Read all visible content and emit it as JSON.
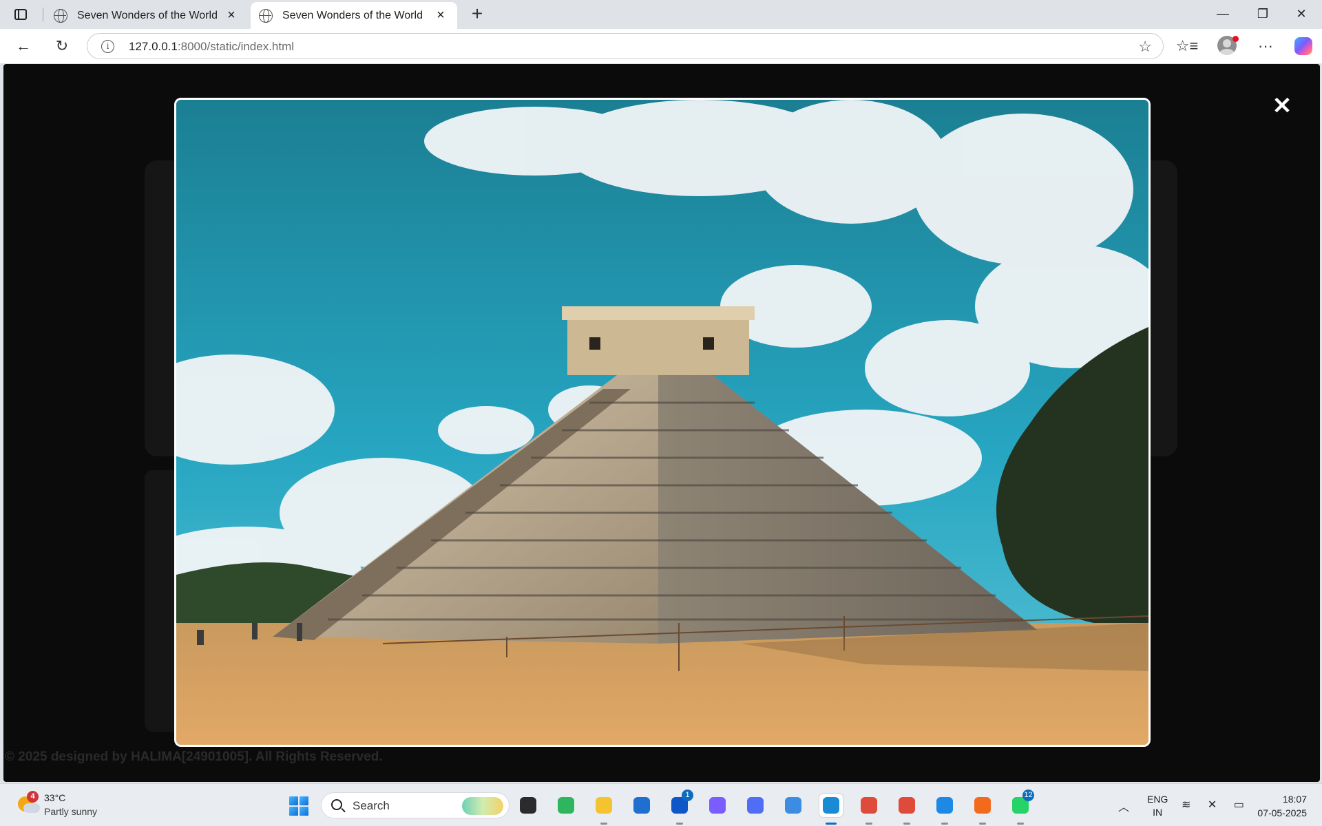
{
  "browser": {
    "tabs": [
      {
        "title": "Seven Wonders of the World",
        "active": false
      },
      {
        "title": "Seven Wonders of the World",
        "active": true
      }
    ],
    "new_tab_symbol": "+",
    "url_host": "127.0.0.1",
    "url_path": ":8000/static/index.html",
    "window_controls": {
      "minimize": "—",
      "restore": "❐",
      "close": "✕"
    }
  },
  "page": {
    "close_symbol": "✕",
    "footer": "© 2025 designed by HALIMA[24901005]. All Rights Reserved."
  },
  "taskbar": {
    "weather": {
      "temp": "33°C",
      "desc": "Partly sunny",
      "badge": "4"
    },
    "search_label": "Search",
    "apps": [
      {
        "name": "task-view",
        "color": "#2b2b2b"
      },
      {
        "name": "copilot-ring",
        "color": "#2fb55d"
      },
      {
        "name": "file-explorer",
        "color": "#f4c430"
      },
      {
        "name": "microsoft-store",
        "color": "#1f6fd1"
      },
      {
        "name": "l-app",
        "color": "#0f56c9",
        "badge": "1"
      },
      {
        "name": "copilot",
        "color": "#7b5cff"
      },
      {
        "name": "arc-app",
        "color": "#4f6df5"
      },
      {
        "name": "snipping-tool",
        "color": "#3a8de0"
      },
      {
        "name": "edge",
        "color": "#1a8ad4"
      },
      {
        "name": "chrome",
        "color": "#e04a3a"
      },
      {
        "name": "chrome-2",
        "color": "#e04a3a"
      },
      {
        "name": "vscode",
        "color": "#1e88e5"
      },
      {
        "name": "fiis-app",
        "color": "#f26a1b"
      },
      {
        "name": "whatsapp",
        "color": "#25d366",
        "badge": "12"
      }
    ],
    "lang_line1": "ENG",
    "lang_line2": "IN",
    "time": "18:07",
    "date": "07-05-2025"
  }
}
